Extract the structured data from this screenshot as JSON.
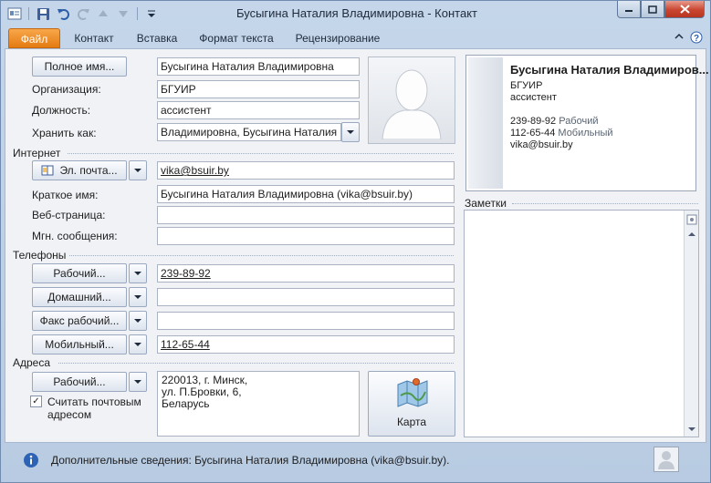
{
  "window": {
    "title": "Бусыгина Наталия Владимировна  -  Контакт"
  },
  "tabs": [
    "Файл",
    "Контакт",
    "Вставка",
    "Формат текста",
    "Рецензирование"
  ],
  "form": {
    "full_name_button": "Полное имя...",
    "full_name": "Бусыгина Наталия Владимировна",
    "company_label": "Организация:",
    "company": "БГУИР",
    "job_title_label": "Должность:",
    "job_title": "ассистент",
    "file_as_label": "Хранить как:",
    "file_as": "Владимировна, Бусыгина Наталия"
  },
  "internet": {
    "section": "Интернет",
    "email_button": "Эл. почта...",
    "email": "vika@bsuir.by",
    "display_as_label": "Краткое имя:",
    "display_as": "Бусыгина Наталия Владимировна (vika@bsuir.by)",
    "web_label": "Веб-страница:",
    "web": "",
    "im_label": "Мгн. сообщения:",
    "im": ""
  },
  "phones": {
    "section": "Телефоны",
    "items": [
      {
        "label": "Рабочий...",
        "value": "239-89-92"
      },
      {
        "label": "Домашний...",
        "value": ""
      },
      {
        "label": "Факс рабочий...",
        "value": ""
      },
      {
        "label": "Мобильный...",
        "value": "112-65-44"
      }
    ]
  },
  "addresses": {
    "section": "Адреса",
    "type_button": "Рабочий...",
    "lines": [
      "220013, г. Минск,",
      "ул. П.Бровки, 6,",
      "Беларусь"
    ],
    "mailing_checkbox_line1": "Считать почтовым",
    "mailing_checkbox_line2": "адресом",
    "mailing_checked": true,
    "map_button": "Карта"
  },
  "card": {
    "name": "Бусыгина Наталия Владимиров...",
    "company": "БГУИР",
    "title": "ассистент",
    "phone_work": "239-89-92",
    "phone_work_label": "Рабочий",
    "phone_mobile": "112-65-44",
    "phone_mobile_label": "Мобильный",
    "email": "vika@bsuir.by"
  },
  "notes": {
    "label": "Заметки",
    "text": ""
  },
  "status": {
    "text": "Дополнительные сведения: Бусыгина Наталия Владимировна (vika@bsuir.by)."
  }
}
